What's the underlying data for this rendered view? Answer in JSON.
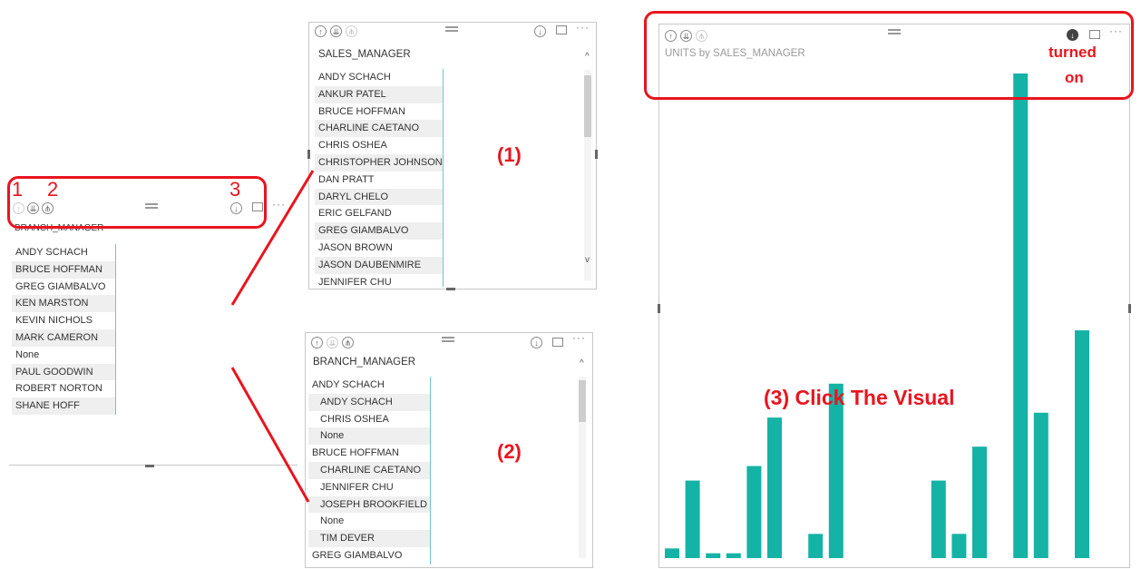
{
  "sales_slicer": {
    "title": "SALES_MANAGER",
    "items": [
      "ANDY SCHACH",
      "ANKUR PATEL",
      "BRUCE HOFFMAN",
      "CHARLINE CAETANO",
      "CHRIS OSHEA",
      "CHRISTOPHER JOHNSON",
      "DAN PRATT",
      "DARYL CHELO",
      "ERIC GELFAND",
      "GREG GIAMBALVO",
      "JASON BROWN",
      "JASON DAUBENMIRE",
      "JENNIFER CHU"
    ]
  },
  "branch_slicer": {
    "title": "BRANCH_MANAGER",
    "items": [
      "ANDY SCHACH",
      "BRUCE HOFFMAN",
      "GREG GIAMBALVO",
      "KEN MARSTON",
      "KEVIN NICHOLS",
      "MARK CAMERON",
      "None",
      "PAUL GOODWIN",
      "ROBERT NORTON",
      "SHANE HOFF"
    ]
  },
  "hier_slicer": {
    "title": "BRANCH_MANAGER",
    "items": [
      {
        "label": "ANDY SCHACH",
        "level": 0
      },
      {
        "label": "ANDY SCHACH",
        "level": 1
      },
      {
        "label": "CHRIS OSHEA",
        "level": 1
      },
      {
        "label": "None",
        "level": 1
      },
      {
        "label": "BRUCE HOFFMAN",
        "level": 0
      },
      {
        "label": "CHARLINE CAETANO",
        "level": 1
      },
      {
        "label": "JENNIFER CHU",
        "level": 1
      },
      {
        "label": "JOSEPH BROOKFIELD",
        "level": 1
      },
      {
        "label": "None",
        "level": 1
      },
      {
        "label": "TIM DEVER",
        "level": 1
      },
      {
        "label": "GREG GIAMBALVO",
        "level": 0
      }
    ]
  },
  "chart": {
    "title": "UNITS by SALES_MANAGER"
  },
  "chart_data": {
    "type": "bar",
    "title": "UNITS by SALES_MANAGER",
    "values": [
      2,
      16,
      1,
      1,
      19,
      29,
      0,
      5,
      36,
      0,
      0,
      0,
      0,
      16,
      5,
      23,
      0,
      100,
      30,
      0,
      47
    ],
    "ylim": [
      0,
      100
    ]
  },
  "annotations": {
    "label_1": "1",
    "label_2": "2",
    "label_3": "3",
    "paren_1": "(1)",
    "paren_2": "(2)",
    "click_visual": "(3) Click The Visual",
    "turned": "turned",
    "on": "on"
  },
  "icons": {
    "drill_up": "↑",
    "drill_down_on": "⇊",
    "expand": "⋔",
    "drill_mode": "↓"
  },
  "colors": {
    "bar": "#15b3a6",
    "annotation": "#e8151f",
    "slicer_border": "#6fc6c4"
  }
}
